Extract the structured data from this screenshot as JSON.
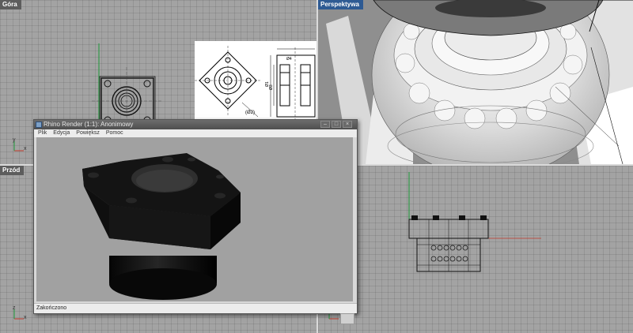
{
  "viewports": {
    "top": {
      "title": "Góra"
    },
    "front": {
      "title": "Przód"
    },
    "perspective": {
      "title": "Perspektywa"
    },
    "right": {
      "title": ""
    }
  },
  "axes": {
    "x": "x",
    "y": "y",
    "z": "z"
  },
  "render_window": {
    "title": "Rhino Render (1:1): Anonimowy",
    "menu": [
      "Plik",
      "Edycja",
      "Powiększ",
      "Pomoc"
    ],
    "controls": {
      "minimize": "–",
      "maximize": "□",
      "close": "×"
    },
    "status": "Zakończono"
  },
  "drawing": {
    "dimensions": [
      "Ø1",
      "Ø3",
      "Ø4",
      "(Ø2)"
    ]
  },
  "colors": {
    "active_title": "#2e5a93",
    "inactive_title": "#5d5d5d",
    "x_axis": "#c0392b",
    "y_axis": "#1e9a3a"
  }
}
